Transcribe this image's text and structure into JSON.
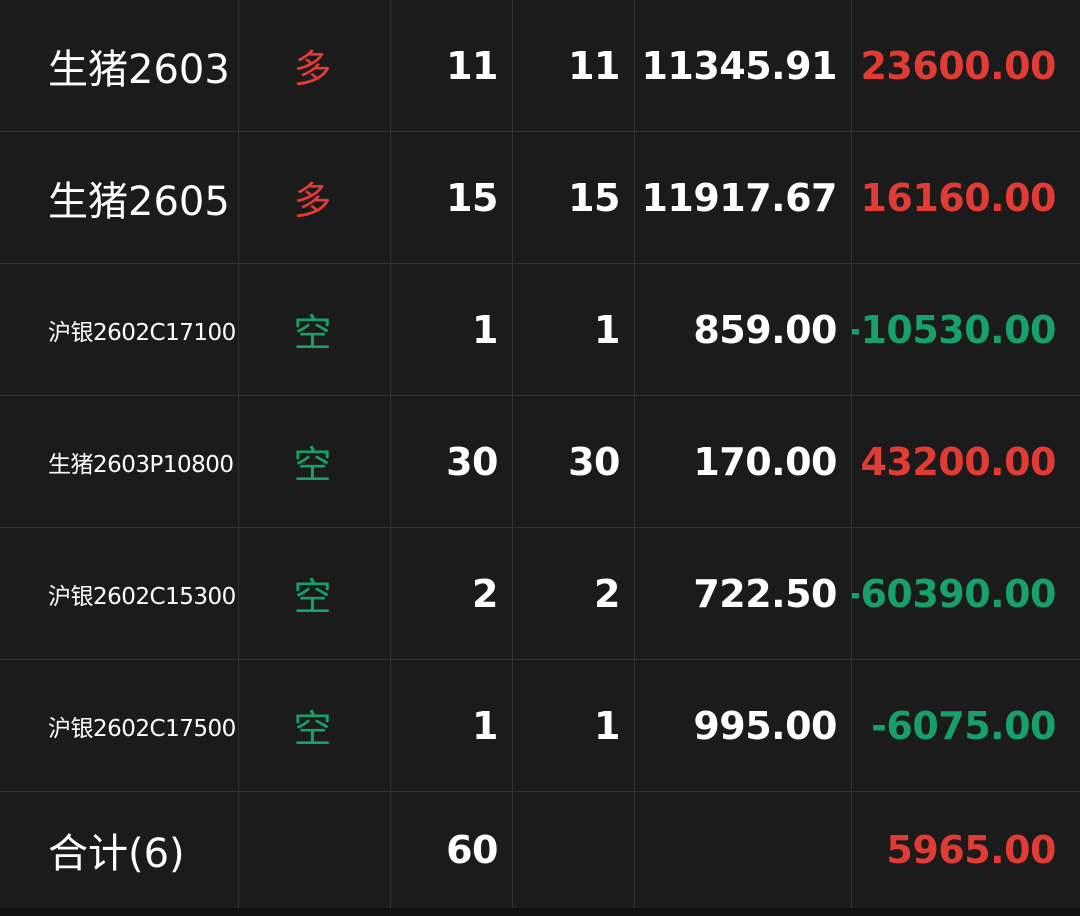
{
  "colors": {
    "background": "#1b1b1b",
    "grid_line": "#333333",
    "long_red": "#e03b35",
    "short_green": "#18a06a",
    "text": "#ffffff"
  },
  "positions": [
    {
      "contract": "生猪2603",
      "direction": "多",
      "dir_type": "long",
      "qty": "11",
      "available": "11",
      "avg_price": "11345.91",
      "pnl": "23600.00",
      "pnl_sign": "pos",
      "name_size": "lg"
    },
    {
      "contract": "生猪2605",
      "direction": "多",
      "dir_type": "long",
      "qty": "15",
      "available": "15",
      "avg_price": "11917.67",
      "pnl": "16160.00",
      "pnl_sign": "pos",
      "name_size": "lg"
    },
    {
      "contract": "沪银2602C17100",
      "direction": "空",
      "dir_type": "short",
      "qty": "1",
      "available": "1",
      "avg_price": "859.00",
      "pnl": "-10530.00",
      "pnl_sign": "neg",
      "name_size": "sm"
    },
    {
      "contract": "生猪2603P10800",
      "direction": "空",
      "dir_type": "short",
      "qty": "30",
      "available": "30",
      "avg_price": "170.00",
      "pnl": "43200.00",
      "pnl_sign": "pos",
      "name_size": "sm"
    },
    {
      "contract": "沪银2602C15300",
      "direction": "空",
      "dir_type": "short",
      "qty": "2",
      "available": "2",
      "avg_price": "722.50",
      "pnl": "-60390.00",
      "pnl_sign": "neg",
      "name_size": "sm"
    },
    {
      "contract": "沪银2602C17500",
      "direction": "空",
      "dir_type": "short",
      "qty": "1",
      "available": "1",
      "avg_price": "995.00",
      "pnl": "-6075.00",
      "pnl_sign": "neg",
      "name_size": "sm"
    }
  ],
  "total": {
    "label": "合计(6)",
    "qty": "60",
    "pnl": "5965.00"
  }
}
